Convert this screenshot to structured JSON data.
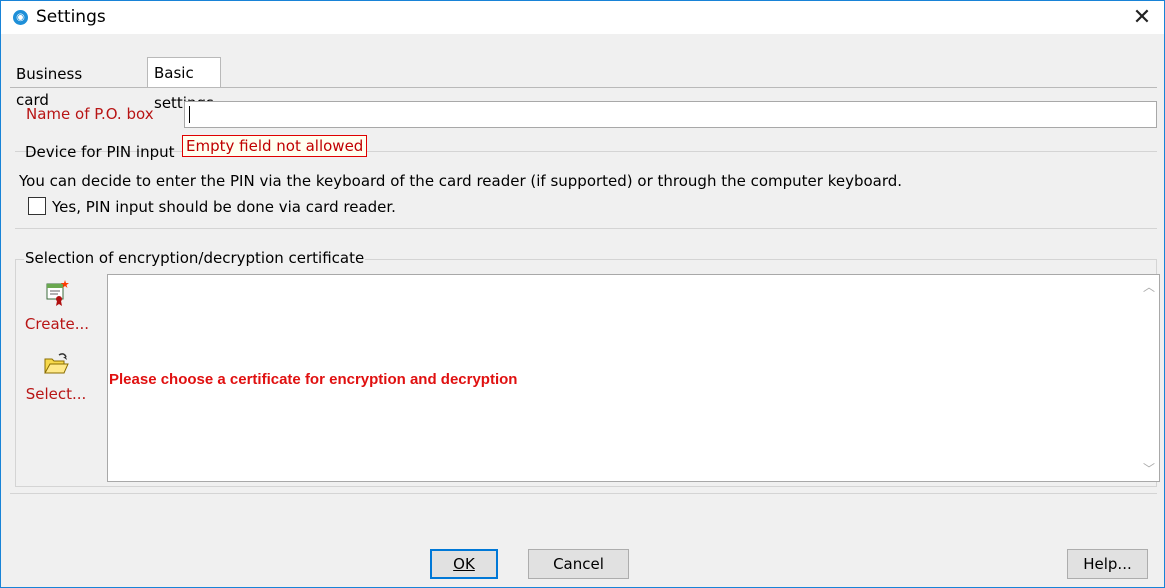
{
  "window": {
    "title": "Settings",
    "close_glyph": "✕"
  },
  "tabs": [
    {
      "label": "Business card",
      "active": false
    },
    {
      "label": "Basic settings",
      "active": true
    }
  ],
  "po_box": {
    "label": "Name of P.O. box",
    "value": "",
    "error_tooltip": "Empty field not allowed"
  },
  "pin": {
    "heading": "Device for PIN input",
    "description": "You can decide to enter the PIN via the keyboard of the card reader (if supported) or through the computer keyboard.",
    "checkbox_label": "Yes, PIN input should be done via card reader.",
    "checked": false
  },
  "certificate": {
    "group_title": "Selection of encryption/decryption certificate",
    "create_label": "Create...",
    "select_label": "Select...",
    "message": "Please choose a certificate for encryption and decryption"
  },
  "buttons": {
    "ok_label": "OK",
    "cancel_label": "Cancel",
    "help_label": "Help..."
  },
  "colors": {
    "accent": "#0078d7",
    "label_red": "#b81515",
    "error_red": "#e01010"
  }
}
